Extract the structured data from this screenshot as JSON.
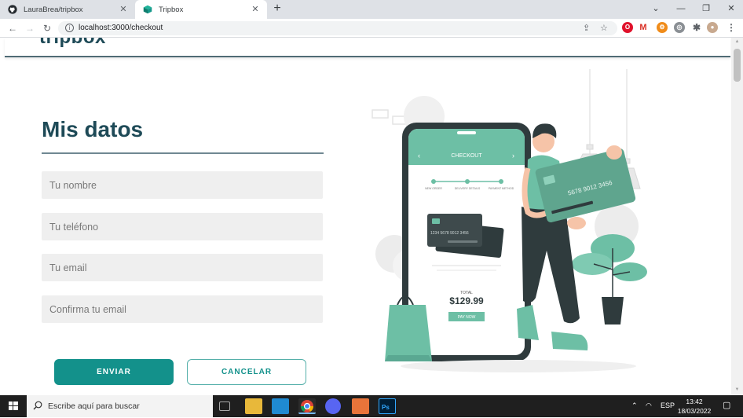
{
  "browser": {
    "tabs": [
      {
        "title": "LauraBrea/tripbox",
        "icon": "github-icon",
        "active": false
      },
      {
        "title": "Tripbox",
        "icon": "tripbox-cube-icon",
        "active": true
      }
    ],
    "url": "localhost:3000/checkout"
  },
  "site": {
    "logo": "tripbox"
  },
  "form": {
    "title": "Mis datos",
    "fields": {
      "name_placeholder": "Tu nombre",
      "phone_placeholder": "Tu teléfono",
      "email_placeholder": "Tu email",
      "confirm_email_placeholder": "Confirma tu email"
    },
    "send_label": "ENVIAR",
    "cancel_label": "CANCELAR"
  },
  "illustration": {
    "screen_title": "CHECKOUT",
    "steps": [
      "NEW ORDER",
      "DELIVERY DETAILS",
      "PAYMENT METHOD"
    ],
    "card_number_small": "1234 5678 9012 3456",
    "card_number_large": "5678 9012 3456",
    "total_label": "TOTAL",
    "total_amount": "$129.99",
    "pay_label": "PAY NOW",
    "accent_color": "#6dbfa5",
    "dark_color": "#2f3b3d"
  },
  "taskbar": {
    "search_placeholder": "Escribe aquí para buscar",
    "language": "ESP",
    "time": "13:42",
    "date": "18/03/2022"
  }
}
